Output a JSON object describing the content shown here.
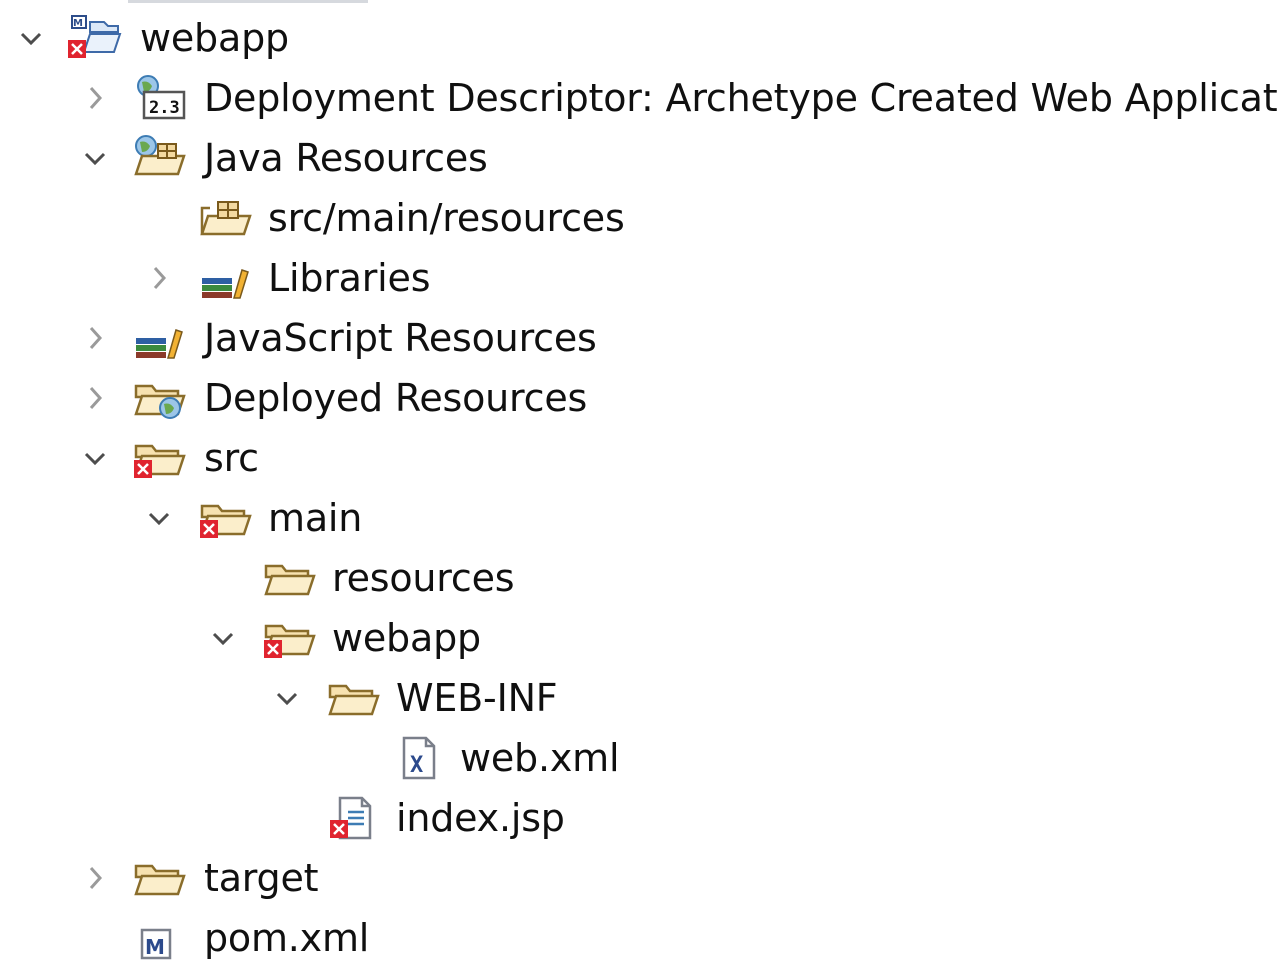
{
  "tree": {
    "root": {
      "label": "webapp",
      "expanded": true,
      "icon": "maven-web-project-error-icon"
    },
    "deployment_descriptor": {
      "label": "Deployment Descriptor: Archetype Created Web Application",
      "expanded": false,
      "icon": "deployment-descriptor-icon"
    },
    "java_resources": {
      "label": "Java Resources",
      "expanded": true,
      "icon": "java-resources-icon"
    },
    "src_main_resources": {
      "label": "src/main/resources",
      "icon": "source-folder-icon"
    },
    "libraries": {
      "label": "Libraries",
      "expanded": false,
      "icon": "libraries-icon"
    },
    "javascript_resources": {
      "label": "JavaScript Resources",
      "expanded": false,
      "icon": "libraries-icon"
    },
    "deployed_resources": {
      "label": "Deployed Resources",
      "expanded": false,
      "icon": "deployed-resources-icon"
    },
    "src": {
      "label": "src",
      "expanded": true,
      "icon": "folder-error-icon"
    },
    "main": {
      "label": "main",
      "expanded": true,
      "icon": "folder-error-icon"
    },
    "resources": {
      "label": "resources",
      "icon": "folder-icon"
    },
    "webapp_folder": {
      "label": "webapp",
      "expanded": true,
      "icon": "folder-error-icon"
    },
    "web_inf": {
      "label": "WEB-INF",
      "expanded": true,
      "icon": "folder-icon"
    },
    "web_xml": {
      "label": "web.xml",
      "icon": "xml-file-icon"
    },
    "index_jsp": {
      "label": "index.jsp",
      "icon": "jsp-file-error-icon"
    },
    "target": {
      "label": "target",
      "expanded": false,
      "icon": "folder-icon"
    },
    "pom_xml": {
      "label": "pom.xml",
      "icon": "maven-pom-icon"
    }
  },
  "colors": {
    "error_red": "#e0242f",
    "folder_fill": "#f7e2b0",
    "folder_stroke": "#8a6d2b",
    "chevron": "#4d4d4d",
    "text": "#101010"
  }
}
